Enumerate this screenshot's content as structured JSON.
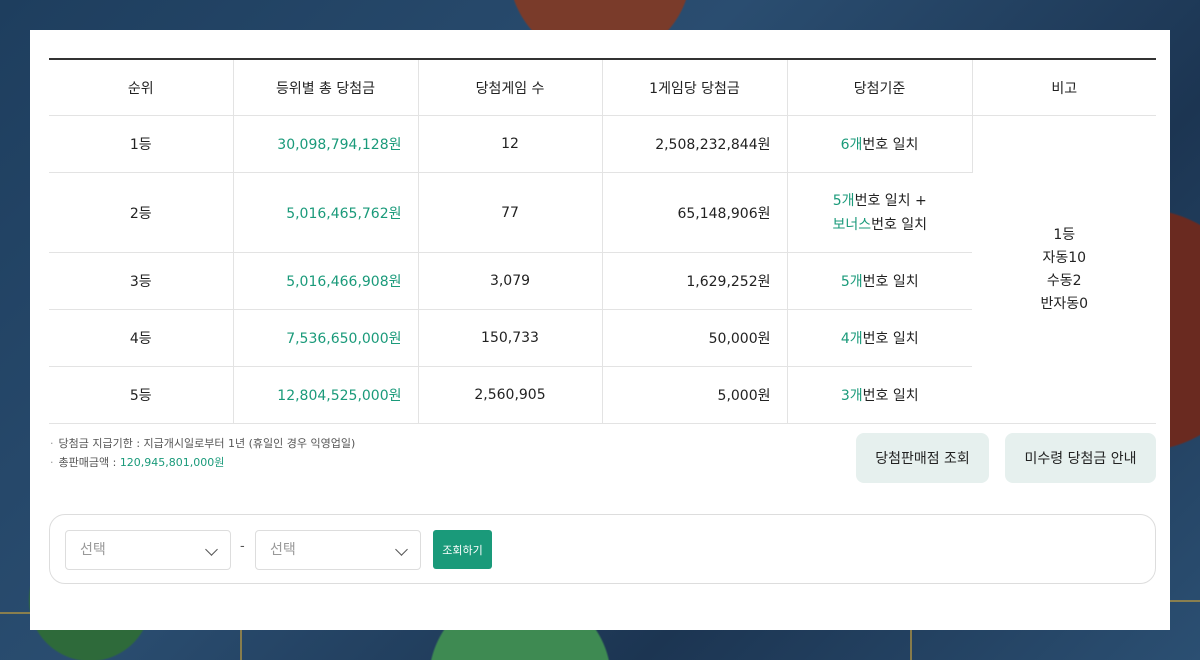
{
  "table": {
    "headers": [
      "순위",
      "등위별 총 당첨금",
      "당첨게임 수",
      "1게임당 당첨금",
      "당첨기준",
      "비고"
    ],
    "rows": [
      {
        "rank": "1등",
        "total": "30,098,794,128원",
        "games": "12",
        "per_game": "2,508,232,844원",
        "criteria_num": "6개",
        "criteria_text": "번호 일치"
      },
      {
        "rank": "2등",
        "total": "5,016,465,762원",
        "games": "77",
        "per_game": "65,148,906원",
        "criteria_num": "5개",
        "criteria_text": "번호 일치 +",
        "criteria_bonus": "보너스",
        "criteria_bonus_text": "번호 일치"
      },
      {
        "rank": "3등",
        "total": "5,016,466,908원",
        "games": "3,079",
        "per_game": "1,629,252원",
        "criteria_num": "5개",
        "criteria_text": "번호 일치"
      },
      {
        "rank": "4등",
        "total": "7,536,650,000원",
        "games": "150,733",
        "per_game": "50,000원",
        "criteria_num": "4개",
        "criteria_text": "번호 일치"
      },
      {
        "rank": "5등",
        "total": "12,804,525,000원",
        "games": "2,560,905",
        "per_game": "5,000원",
        "criteria_num": "3개",
        "criteria_text": "번호 일치"
      }
    ],
    "note_lines": [
      "1등",
      "자동10",
      "수동2",
      "반자동0"
    ]
  },
  "notes": {
    "payment_period": "당첨금 지급기한 : 지급개시일로부터 1년 (휴일인 경우 익영업일)",
    "total_sales_label": "총판매금액 : ",
    "total_sales_value": "120,945,801,000원"
  },
  "buttons": {
    "store_lookup": "당첨판매점 조회",
    "unclaimed_info": "미수령 당첨금 안내"
  },
  "search": {
    "select1": "선택",
    "select2": "선택",
    "separator": "-",
    "submit": "조회하기"
  },
  "colors": {
    "accent": "#1a9a7a",
    "button_bg": "#e6f0ee"
  }
}
